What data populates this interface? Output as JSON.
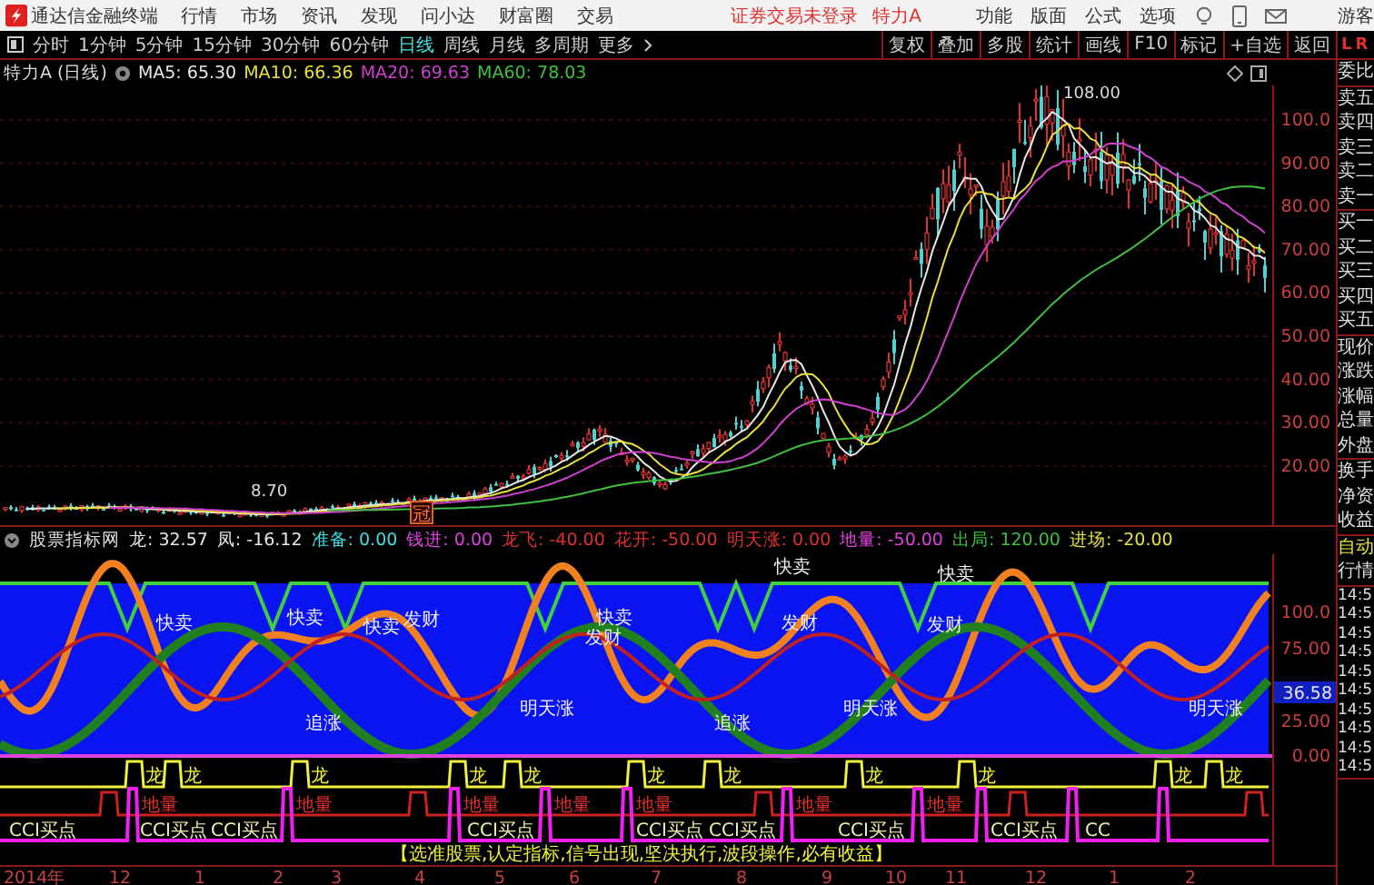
{
  "app": {
    "name": "通达信金融终端",
    "menu": [
      "行情",
      "市场",
      "资讯",
      "发现",
      "问小达",
      "财富圈",
      "交易"
    ],
    "login_status": "证券交易未登录",
    "stock": "特力A",
    "right_menu": [
      "功能",
      "版面",
      "公式",
      "选项"
    ],
    "user": "游客"
  },
  "period_tabs": [
    {
      "label": "分时",
      "selected": false
    },
    {
      "label": "1分钟",
      "selected": false
    },
    {
      "label": "5分钟",
      "selected": false
    },
    {
      "label": "15分钟",
      "selected": false
    },
    {
      "label": "30分钟",
      "selected": false
    },
    {
      "label": "60分钟",
      "selected": false
    },
    {
      "label": "日线",
      "selected": true
    },
    {
      "label": "周线",
      "selected": false
    },
    {
      "label": "月线",
      "selected": false
    },
    {
      "label": "多周期",
      "selected": false
    },
    {
      "label": "更多",
      "selected": false
    }
  ],
  "tools": [
    "复权",
    "叠加",
    "多股",
    "统计",
    "画线",
    "F10",
    "标记",
    "+自选",
    "返回"
  ],
  "side_header": [
    "L",
    "R"
  ],
  "chart": {
    "title": "特力A (日线)",
    "ma": [
      {
        "label": "MA5: 65.30",
        "color": "#e8e8e8"
      },
      {
        "label": "MA10: 66.36",
        "color": "#e8e040"
      },
      {
        "label": "MA20: 69.63",
        "color": "#d040d0"
      },
      {
        "label": "MA60: 78.03",
        "color": "#40c040"
      }
    ],
    "high_label": "108.00",
    "low_label": "8.70",
    "marker": "冠",
    "axis": [
      "100.0",
      "90.00",
      "80.00",
      "70.00",
      "60.00",
      "50.00",
      "40.00",
      "30.00",
      "20.00"
    ]
  },
  "indicator": {
    "name": "股票指标网",
    "values": [
      {
        "label": "龙: 32.57",
        "color": "#e8e8e8"
      },
      {
        "label": "凤: -16.12",
        "color": "#e8e8e8"
      },
      {
        "label": "准备: 0.00",
        "color": "#40e0e0"
      },
      {
        "label": "钱进: 0.00",
        "color": "#e040e0"
      },
      {
        "label": "龙飞: -40.00",
        "color": "#e03030"
      },
      {
        "label": "花开: -50.00",
        "color": "#e03030"
      },
      {
        "label": "明天涨: 0.00",
        "color": "#e03030"
      },
      {
        "label": "地量: -50.00",
        "color": "#e040e0"
      },
      {
        "label": "出局: 120.00",
        "color": "#40c040"
      },
      {
        "label": "进场: -20.00",
        "color": "#e8e040"
      }
    ],
    "axis": [
      "100.0",
      "75.00",
      "25.00",
      "0.00"
    ],
    "current": "36.58",
    "signals": [
      {
        "text": "快卖",
        "kind": "sell"
      },
      {
        "text": "快卖",
        "kind": "sell"
      },
      {
        "text": "快卖",
        "kind": "sell"
      },
      {
        "text": "快卖",
        "kind": "sell"
      },
      {
        "text": "快卖",
        "kind": "sell"
      },
      {
        "text": "快卖",
        "kind": "sell"
      },
      {
        "text": "发财",
        "kind": "sell"
      },
      {
        "text": "发财",
        "kind": "sell"
      },
      {
        "text": "发财",
        "kind": "sell"
      },
      {
        "text": "发财",
        "kind": "sell"
      },
      {
        "text": "追涨",
        "kind": "rise"
      },
      {
        "text": "追涨",
        "kind": "rise"
      },
      {
        "text": "明天涨",
        "kind": "rise"
      },
      {
        "text": "明天涨",
        "kind": "rise"
      },
      {
        "text": "明天涨",
        "kind": "rise"
      },
      {
        "text": "龙",
        "kind": "dragon"
      },
      {
        "text": "龙",
        "kind": "dragon"
      },
      {
        "text": "龙",
        "kind": "dragon"
      },
      {
        "text": "龙",
        "kind": "dragon"
      },
      {
        "text": "龙",
        "kind": "dragon"
      },
      {
        "text": "龙",
        "kind": "dragon"
      },
      {
        "text": "龙",
        "kind": "dragon"
      },
      {
        "text": "龙",
        "kind": "dragon"
      },
      {
        "text": "龙",
        "kind": "dragon"
      },
      {
        "text": "龙",
        "kind": "dragon"
      },
      {
        "text": "龙",
        "kind": "dragon"
      },
      {
        "text": "地量",
        "kind": "ground"
      },
      {
        "text": "地量",
        "kind": "ground"
      },
      {
        "text": "地量",
        "kind": "ground"
      },
      {
        "text": "地量",
        "kind": "ground"
      },
      {
        "text": "地量",
        "kind": "ground"
      },
      {
        "text": "地量",
        "kind": "ground"
      },
      {
        "text": "地量",
        "kind": "ground"
      },
      {
        "text": "CCI买点",
        "kind": "cci"
      },
      {
        "text": "CCI买点",
        "kind": "cci"
      },
      {
        "text": "CCI买点",
        "kind": "cci"
      },
      {
        "text": "CCI买点",
        "kind": "cci"
      },
      {
        "text": "CCI买点",
        "kind": "cci"
      },
      {
        "text": "CCI买点",
        "kind": "cci"
      },
      {
        "text": "CCI买点",
        "kind": "cci"
      },
      {
        "text": "CCI买点",
        "kind": "cci"
      },
      {
        "text": "CC",
        "kind": "cci"
      }
    ],
    "banner": "【选准股票,认定指标,信号出现,坚决执行,波段操作,必有收益】"
  },
  "dates": [
    "2014年",
    "12",
    "1",
    "2",
    "3",
    "4",
    "5",
    "6",
    "7",
    "8",
    "9",
    "10",
    "11",
    "12",
    "1",
    "2"
  ],
  "sidebar": {
    "groups": [
      [
        "委比"
      ],
      [
        "卖五",
        "卖四",
        "卖三",
        "卖二",
        "卖一"
      ],
      [
        "买一",
        "买二",
        "买三",
        "买四",
        "买五"
      ],
      [
        "现价",
        "涨跌",
        "涨幅",
        "总量",
        "外盘"
      ],
      [
        "换手",
        "净资",
        "收益"
      ]
    ],
    "tabs": [
      "自动",
      "行情"
    ],
    "times": [
      "14:5",
      "14:5",
      "14:5",
      "14:5",
      "14:5",
      "14:5",
      "14:5",
      "14:5",
      "14:5",
      "14:5"
    ]
  }
}
